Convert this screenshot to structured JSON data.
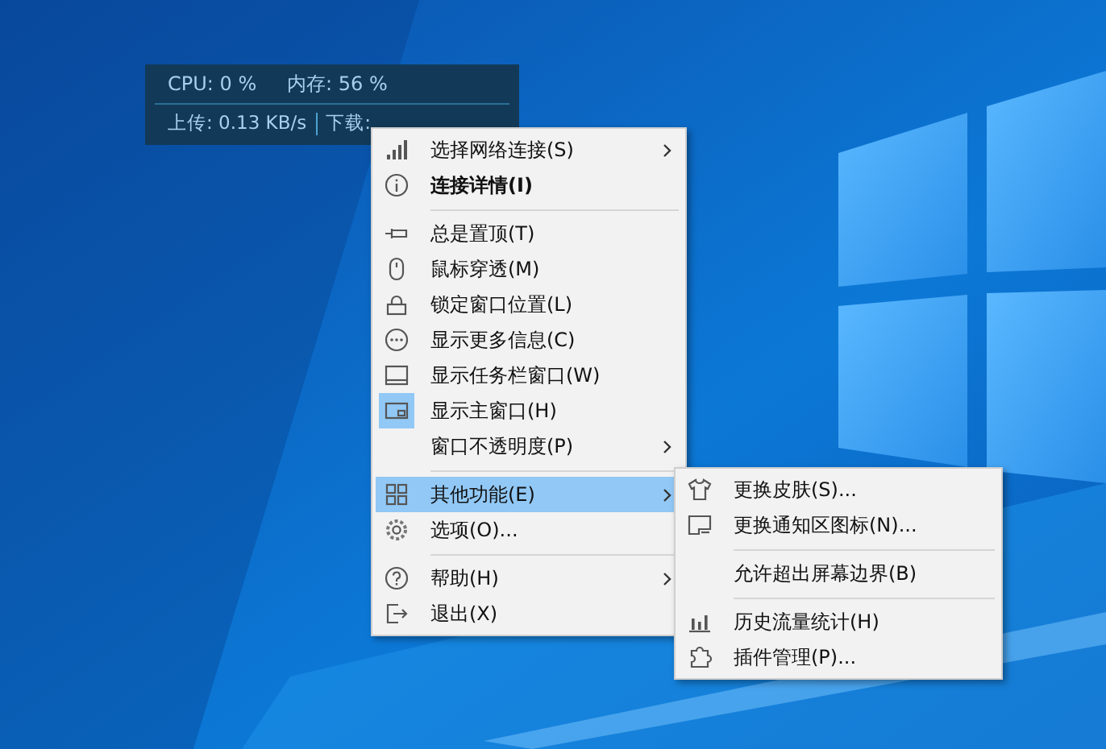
{
  "monitor": {
    "cpu": "CPU: 0 %",
    "memory": "内存: 56 %",
    "upload": "上传: 0.13 KB/s",
    "download": "下载:"
  },
  "menu": {
    "items": [
      {
        "kind": "item",
        "label": "选择网络连接(S)",
        "bold": false,
        "checked": false,
        "selected": false,
        "submenu": true
      },
      {
        "kind": "item",
        "label": "连接详情(I)",
        "bold": true,
        "checked": false,
        "selected": false,
        "submenu": false
      },
      {
        "kind": "separator"
      },
      {
        "kind": "item",
        "label": "总是置顶(T)",
        "bold": false,
        "checked": false,
        "selected": false,
        "submenu": false
      },
      {
        "kind": "item",
        "label": "鼠标穿透(M)",
        "bold": false,
        "checked": false,
        "selected": false,
        "submenu": false
      },
      {
        "kind": "item",
        "label": "锁定窗口位置(L)",
        "bold": false,
        "checked": false,
        "selected": false,
        "submenu": false
      },
      {
        "kind": "item",
        "label": "显示更多信息(C)",
        "bold": false,
        "checked": false,
        "selected": false,
        "submenu": false
      },
      {
        "kind": "item",
        "label": "显示任务栏窗口(W)",
        "bold": false,
        "checked": false,
        "selected": false,
        "submenu": false
      },
      {
        "kind": "item",
        "label": "显示主窗口(H)",
        "bold": false,
        "checked": true,
        "selected": false,
        "submenu": false
      },
      {
        "kind": "item",
        "label": "窗口不透明度(P)",
        "bold": false,
        "checked": false,
        "selected": false,
        "submenu": true
      },
      {
        "kind": "separator"
      },
      {
        "kind": "item",
        "label": "其他功能(E)",
        "bold": false,
        "checked": false,
        "selected": true,
        "submenu": true
      },
      {
        "kind": "item",
        "label": "选项(O)...",
        "bold": false,
        "checked": false,
        "selected": false,
        "submenu": false
      },
      {
        "kind": "separator"
      },
      {
        "kind": "item",
        "label": "帮助(H)",
        "bold": false,
        "checked": false,
        "selected": false,
        "submenu": true
      },
      {
        "kind": "item",
        "label": "退出(X)",
        "bold": false,
        "checked": false,
        "selected": false,
        "submenu": false
      }
    ]
  },
  "submenu": {
    "items": [
      {
        "kind": "item",
        "label": "更换皮肤(S)..."
      },
      {
        "kind": "item",
        "label": "更换通知区图标(N)..."
      },
      {
        "kind": "separator"
      },
      {
        "kind": "item",
        "label": "允许超出屏幕边界(B)"
      },
      {
        "kind": "separator"
      },
      {
        "kind": "item",
        "label": "历史流量统计(H)"
      },
      {
        "kind": "item",
        "label": "插件管理(P)..."
      }
    ]
  }
}
